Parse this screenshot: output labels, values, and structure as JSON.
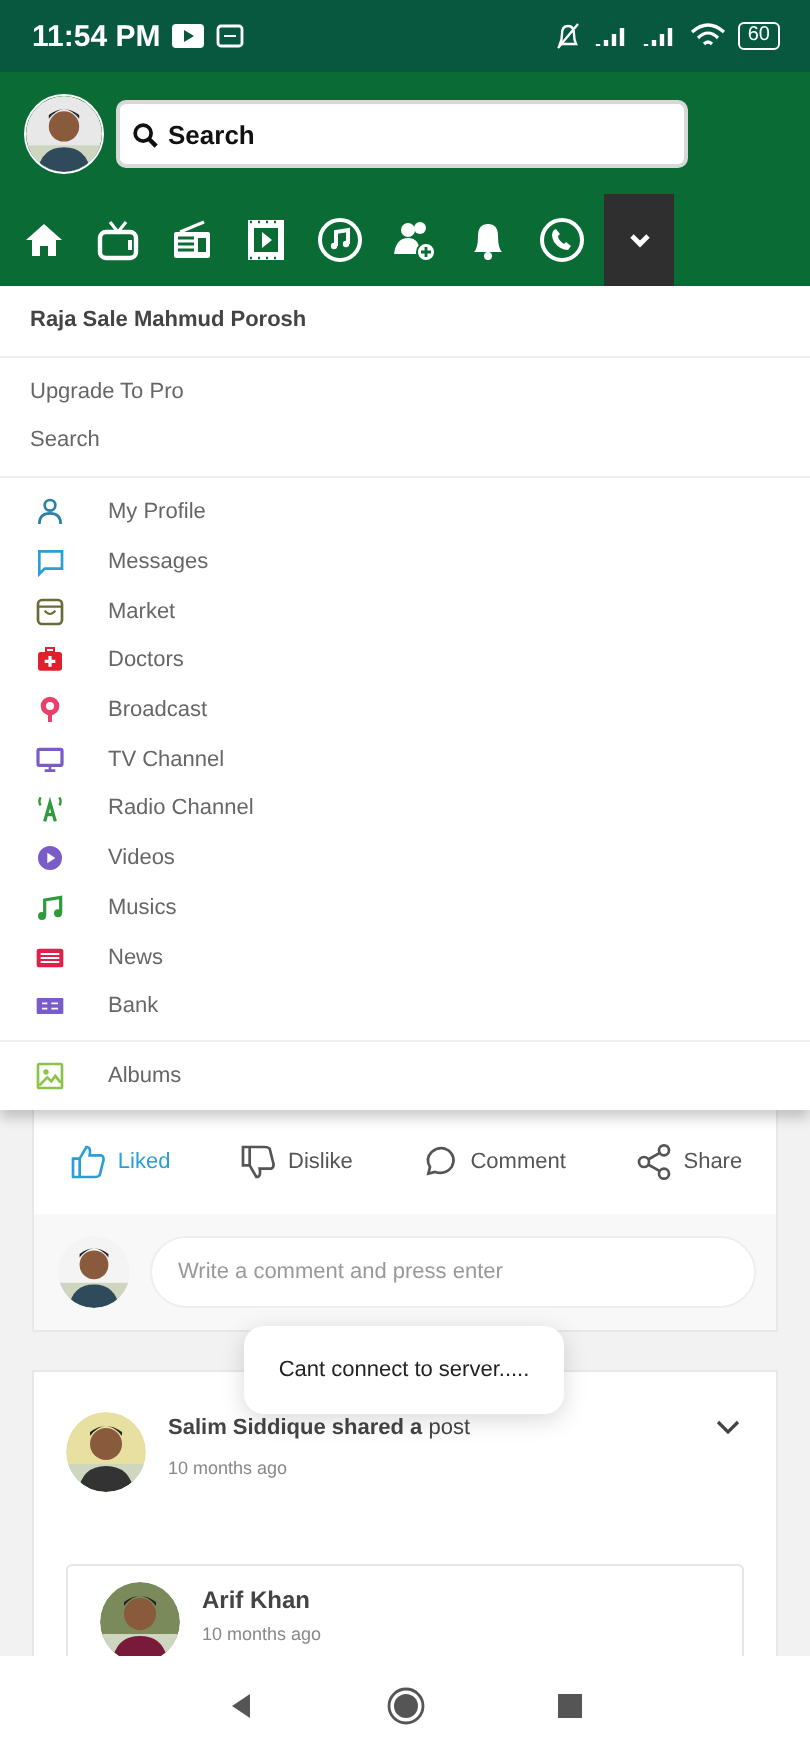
{
  "status_bar": {
    "time": "11:54 PM",
    "battery": "60"
  },
  "header": {
    "search": {
      "placeholder": "Search"
    },
    "menu_toggle": {
      "expanded": true
    }
  },
  "menu": {
    "user_name": "Raja Sale Mahmud Porosh",
    "links": [
      "Upgrade To Pro",
      "Search"
    ],
    "items": [
      {
        "label": "My Profile",
        "color": "#2a7fa8"
      },
      {
        "label": "Messages",
        "color": "#2a9fd6"
      },
      {
        "label": "Market",
        "color": "#6b6b3a"
      },
      {
        "label": "Doctors",
        "color": "#e0202a"
      },
      {
        "label": "Broadcast",
        "color": "#e8406a"
      },
      {
        "label": "TV Channel",
        "color": "#7a5cc8"
      },
      {
        "label": "Radio Channel",
        "color": "#2e9a3a"
      },
      {
        "label": "Videos",
        "color": "#7a5cc8"
      },
      {
        "label": "Musics",
        "color": "#2e9a3a"
      },
      {
        "label": "News",
        "color": "#e0204a"
      },
      {
        "label": "Bank",
        "color": "#7a5cc8"
      }
    ],
    "footer_item": {
      "label": "Albums",
      "color": "#8bc34a"
    }
  },
  "post_actions": [
    {
      "label": "Liked",
      "selected": true
    },
    {
      "label": "Dislike",
      "selected": false
    },
    {
      "label": "Comment",
      "selected": false
    },
    {
      "label": "Share",
      "selected": false
    }
  ],
  "comment_field": {
    "placeholder": "Write a comment and press enter"
  },
  "toast": "Cant connect to server.....",
  "post": {
    "author": "Salim Siddique",
    "action": "shared a",
    "object": "post",
    "time": "10 months ago",
    "shared": {
      "author": "Arif Khan",
      "time": "10 months ago"
    }
  }
}
